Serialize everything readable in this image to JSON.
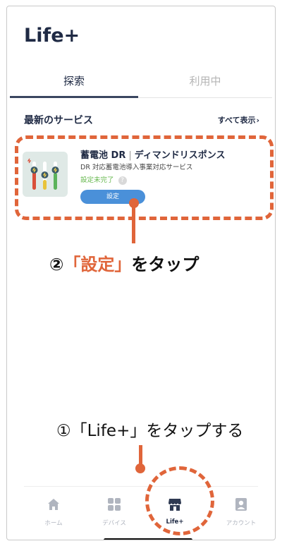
{
  "app": {
    "title": "Life+"
  },
  "tabs": [
    {
      "label": "探索",
      "active": true
    },
    {
      "label": "利用中",
      "active": false
    }
  ],
  "section": {
    "title": "最新のサービス",
    "show_all": "すべて表示",
    "chevron": "›"
  },
  "service": {
    "name": "蓄電池 DR",
    "separator": "|",
    "name_sub": "ディマンドリスポンス",
    "description": "DR 対応蓄電池導入事業対応サービス",
    "status": "設定未完了",
    "help_glyph": "?",
    "button_label": "設定",
    "icon": "battery-slider-icon"
  },
  "annotations": {
    "step2_prefix": "②",
    "step2_highlight": "「設定」",
    "step2_suffix": "をタップ",
    "step1": "①「Life+」をタップする"
  },
  "nav": [
    {
      "label": "ホーム",
      "icon": "home-icon",
      "active": false
    },
    {
      "label": "デバイス",
      "icon": "grid-icon",
      "active": false
    },
    {
      "label": "Life+",
      "icon": "store-icon",
      "active": true
    },
    {
      "label": "アカウント",
      "icon": "account-icon",
      "active": false
    }
  ],
  "colors": {
    "accent_orange": "#e0653a",
    "button_blue": "#4a90d9",
    "status_green": "#67b84f",
    "nav_inactive": "#b0b5bf",
    "title_navy": "#1f2a44"
  }
}
